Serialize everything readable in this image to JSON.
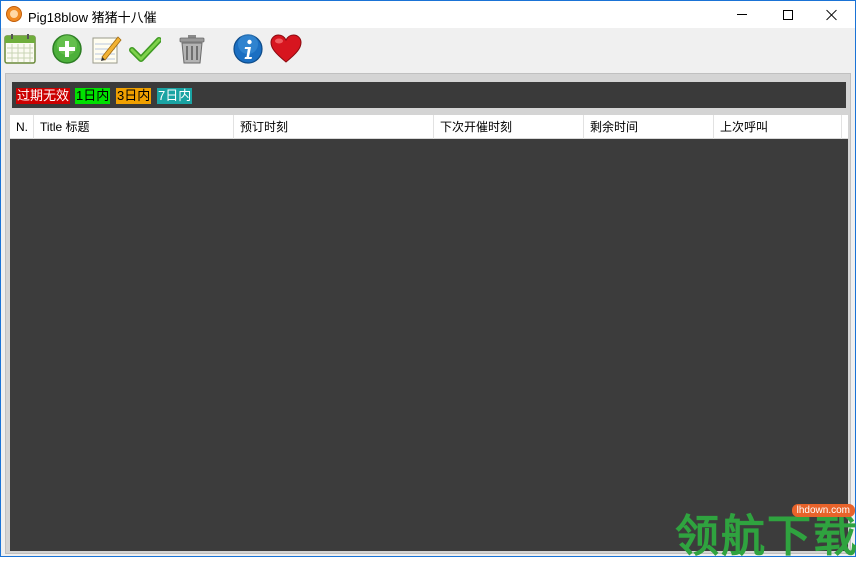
{
  "window": {
    "title": "Pig18blow 猪猪十八催",
    "app_icon": "pig-app-icon",
    "controls": [
      "minimize-icon",
      "maximize-icon",
      "close-icon"
    ]
  },
  "toolbar": {
    "buttons": [
      {
        "name": "calendar-button",
        "icon": "calendar-icon"
      },
      {
        "name": "add-button",
        "icon": "plus-circle-icon",
        "color": "#3fa535"
      },
      {
        "name": "edit-button",
        "icon": "pencil-notepad-icon"
      },
      {
        "name": "done-button",
        "icon": "checkmark-icon",
        "color": "#4caf2a"
      },
      {
        "name": "delete-button",
        "icon": "trash-icon"
      },
      {
        "name": "info-button",
        "icon": "info-circle-icon",
        "color": "#1769b8"
      },
      {
        "name": "favorite-button",
        "icon": "heart-icon",
        "color": "#d9121c"
      }
    ]
  },
  "legend": {
    "items": [
      {
        "label": "过期无效",
        "bg": "#cc0000",
        "fg": "#ffffff"
      },
      {
        "label": "1日内",
        "bg": "#00e000",
        "fg": "#000000"
      },
      {
        "label": "3日内",
        "bg": "#f0a000",
        "fg": "#000000"
      },
      {
        "label": "7日内",
        "bg": "#1aa3a3",
        "fg": "#ffffff"
      }
    ]
  },
  "table": {
    "columns": [
      "N.",
      "Title 标题",
      "预订时刻",
      "下次开催时刻",
      "剩余时间",
      "上次呼叫"
    ],
    "rows": []
  },
  "watermark": {
    "text": "领航下载",
    "site": "lhdown.com"
  }
}
